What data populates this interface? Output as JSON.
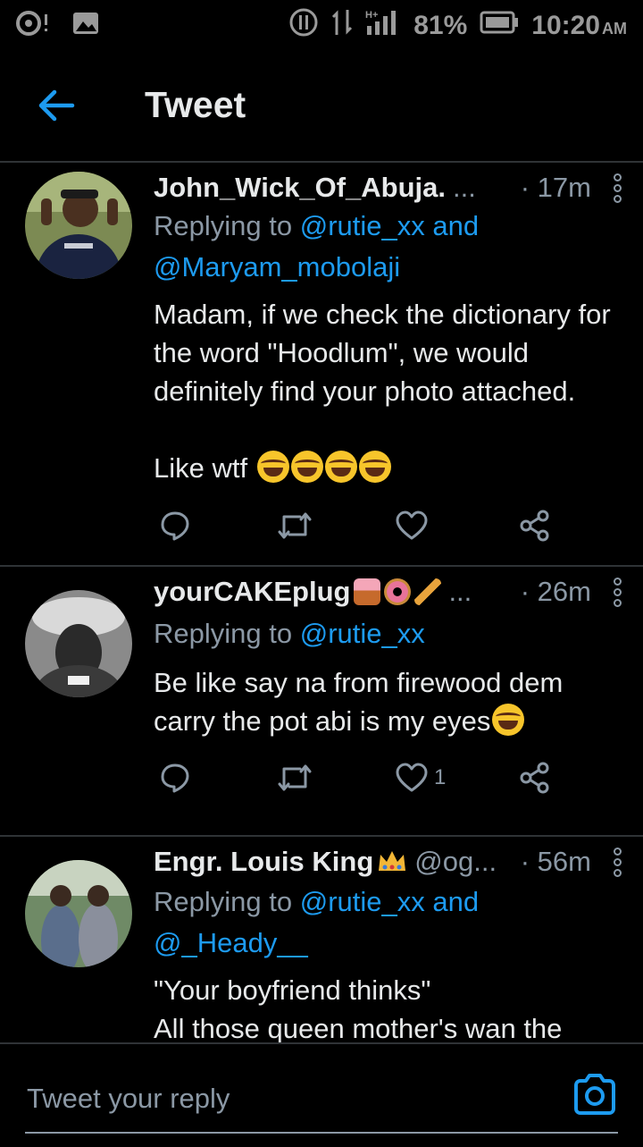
{
  "status_bar": {
    "battery": "81%",
    "time": "10:20",
    "time_suffix": "AM",
    "network": "H+"
  },
  "header": {
    "title": "Tweet",
    "back_icon": "arrow-left-icon"
  },
  "tweets": [
    {
      "name": "John_Wick_Of_Abuja.",
      "handle": "",
      "truncation": "...",
      "time": "· 17m",
      "reply_prefix": "Replying to ",
      "mentions": [
        "@rutie_xx",
        "@Maryam_mobolaji"
      ],
      "joiner": " and",
      "body": "Madam, if we check the dictionary for the word \"Hoodlum\", we would definitely find your photo attached.\n\nLike wtf",
      "like_count": ""
    },
    {
      "name": "yourCAKEplug",
      "handle": "",
      "truncation": "...",
      "time": "· 26m",
      "reply_prefix": "Replying to ",
      "mentions": [
        "@rutie_xx"
      ],
      "joiner": "",
      "body": "Be like say na from firewood dem carry the pot abi is my eyes",
      "like_count": "1"
    },
    {
      "name": "Engr. Louis King",
      "handle": "@og...",
      "truncation": "",
      "time": "· 56m",
      "reply_prefix": "Replying to ",
      "mentions": [
        "@rutie_xx",
        "@_Heady__"
      ],
      "joiner": " and",
      "body": "\"Your boyfriend thinks\"\nAll those queen mother's wan the",
      "like_count": ""
    }
  ],
  "reply_bar": {
    "placeholder": "Tweet your reply"
  },
  "colors": {
    "background": "#000000",
    "accent": "#1d9bf0",
    "muted": "#8b98a5",
    "divider": "#2f3336"
  }
}
